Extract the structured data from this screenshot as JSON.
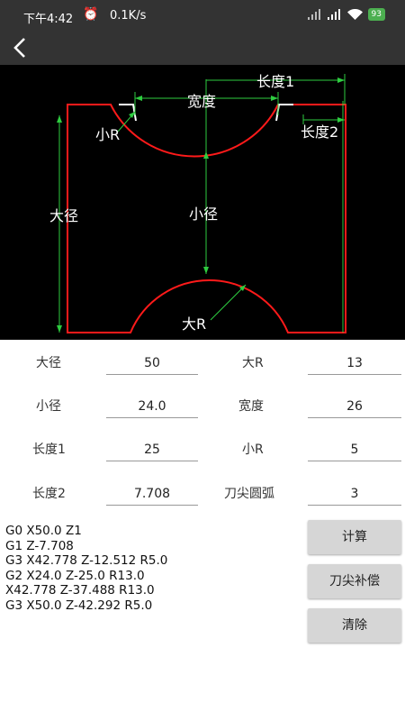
{
  "status": {
    "time": "下午4:42",
    "alarm_icon": "alarm-clock-icon",
    "speed": "0.1K/s",
    "battery": "93"
  },
  "toolbar": {
    "back_icon": "chevron-left-icon"
  },
  "diagram": {
    "labels": {
      "length1": "长度1",
      "width": "宽度",
      "small_r": "小R",
      "length2": "长度2",
      "big_diameter": "大径",
      "small_diameter": "小径",
      "big_r": "大R"
    },
    "colors": {
      "profile": "#ff1a1a",
      "dimension": "#2ecc40",
      "background": "#000000",
      "corner": "#ffffff"
    }
  },
  "form": {
    "rows": [
      {
        "left_label": "大径",
        "left_value": "50",
        "right_label": "大R",
        "right_value": "13"
      },
      {
        "left_label": "小径",
        "left_value": "24.0",
        "right_label": "宽度",
        "right_value": "26"
      },
      {
        "left_label": "长度1",
        "left_value": "25",
        "right_label": "小R",
        "right_value": "5"
      },
      {
        "left_label": "长度2",
        "left_value": "7.708",
        "right_label": "刀尖圆弧",
        "right_value": "3"
      }
    ]
  },
  "gcode": {
    "lines": [
      "G0 X50.0 Z1",
      "G1 Z-7.708",
      "G3 X42.778 Z-12.512 R5.0",
      "G2 X24.0 Z-25.0 R13.0",
      "X42.778 Z-37.488 R13.0",
      "G3 X50.0 Z-42.292 R5.0"
    ]
  },
  "buttons": {
    "calculate": "计算",
    "tool_tip_comp": "刀尖补偿",
    "clear": "清除"
  }
}
